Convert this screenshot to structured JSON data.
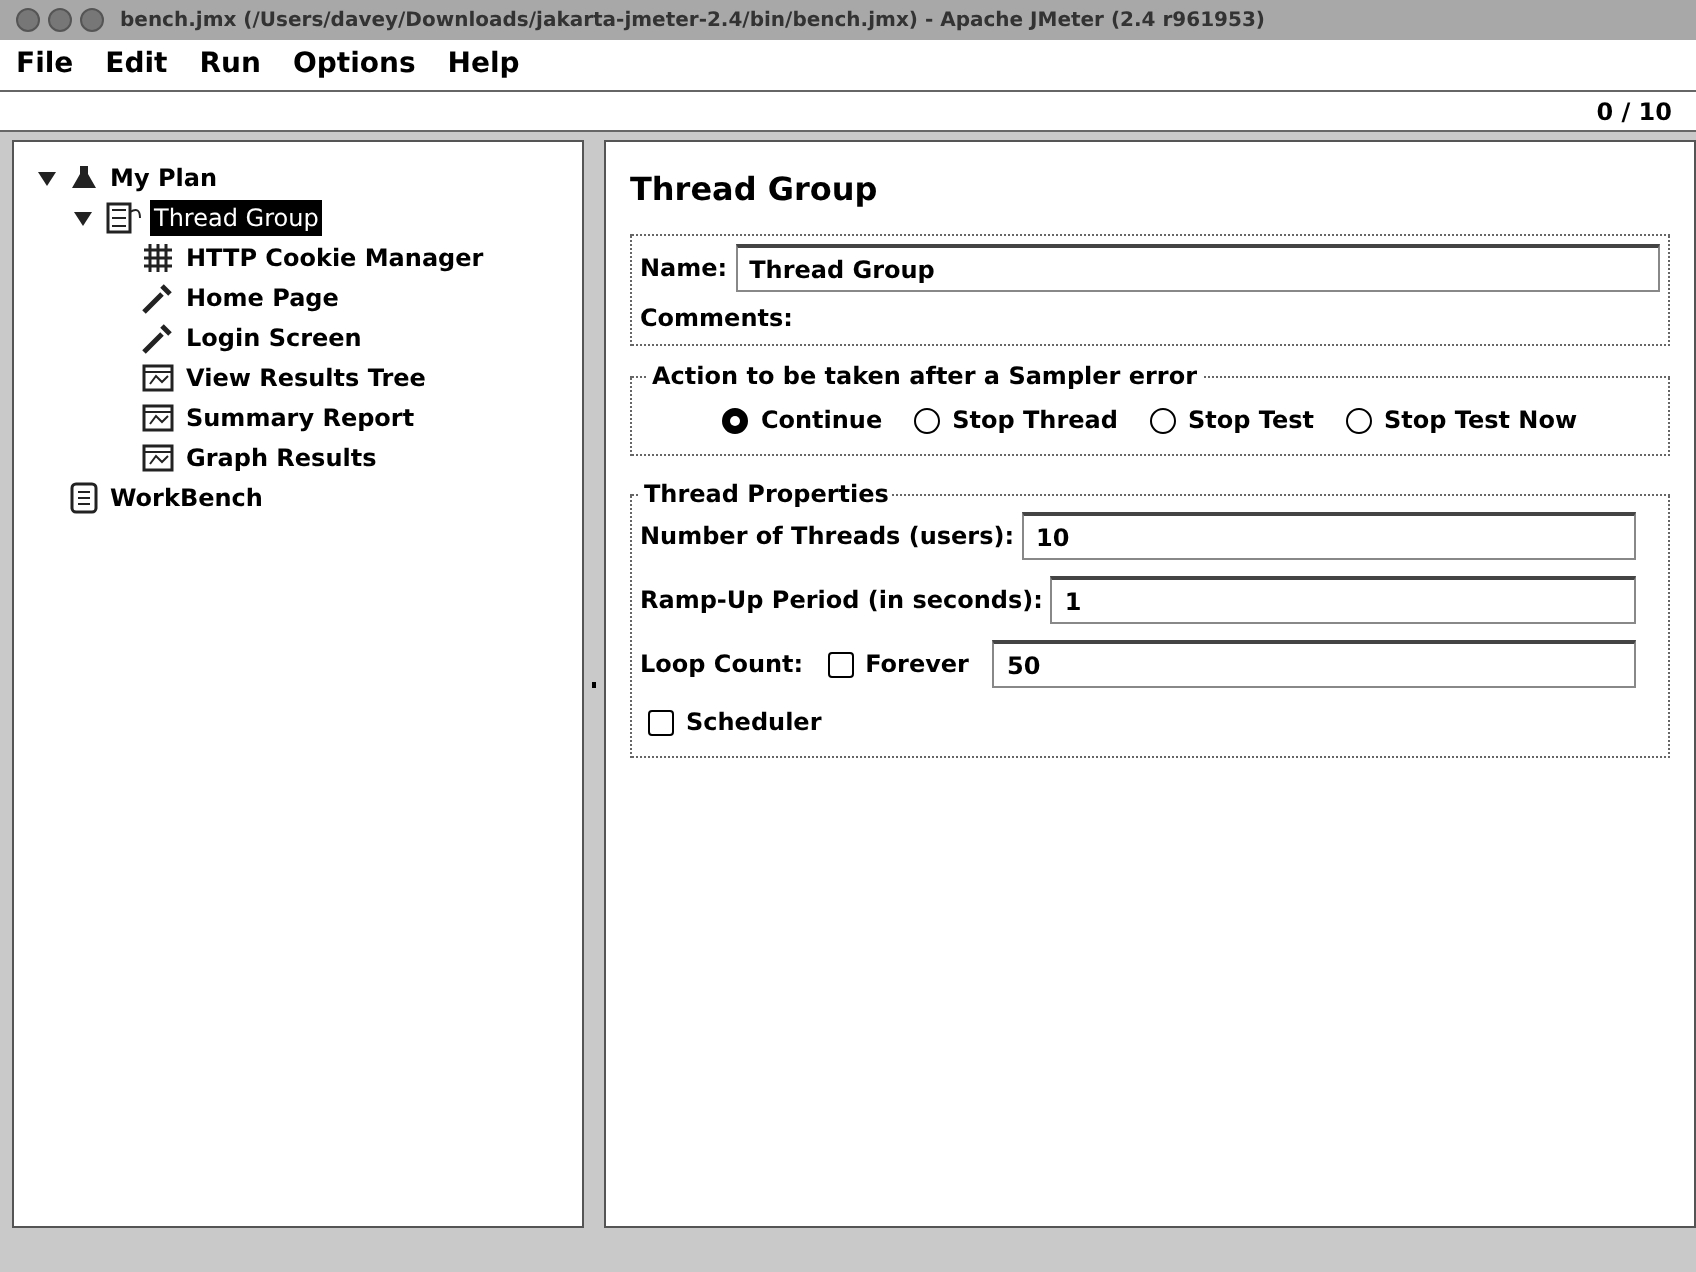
{
  "window": {
    "title": "bench.jmx (/Users/davey/Downloads/jakarta-jmeter-2.4/bin/bench.jmx) - Apache JMeter (2.4 r961953)"
  },
  "menu": [
    "File",
    "Edit",
    "Run",
    "Options",
    "Help"
  ],
  "toolbar": {
    "thread_count": "0 / 10"
  },
  "tree": [
    {
      "label": "My Plan",
      "kind": "plan",
      "selected": false,
      "expanded": true,
      "children": [
        {
          "label": "Thread Group",
          "kind": "threads",
          "selected": true,
          "expanded": true,
          "children": [
            {
              "label": "HTTP Cookie Manager",
              "kind": "config",
              "selected": false
            },
            {
              "label": "Home Page",
              "kind": "sampler",
              "selected": false
            },
            {
              "label": "Login Screen",
              "kind": "sampler",
              "selected": false
            },
            {
              "label": "View Results Tree",
              "kind": "listener",
              "selected": false
            },
            {
              "label": "Summary Report",
              "kind": "listener",
              "selected": false
            },
            {
              "label": "Graph Results",
              "kind": "listener",
              "selected": false
            }
          ]
        }
      ]
    },
    {
      "label": "WorkBench",
      "kind": "workbench",
      "selected": false
    }
  ],
  "panel": {
    "title": "Thread Group",
    "name_label": "Name:",
    "name_value": "Thread Group",
    "comments_label": "Comments:",
    "error_group": {
      "legend": "Action to be taken after a Sampler error",
      "options": [
        {
          "label": "Continue",
          "selected": true
        },
        {
          "label": "Stop Thread",
          "selected": false
        },
        {
          "label": "Stop Test",
          "selected": false
        },
        {
          "label": "Stop Test Now",
          "selected": false
        }
      ]
    },
    "properties": {
      "legend": "Thread Properties",
      "threads_label": "Number of Threads (users):",
      "threads_value": "10",
      "rampup_label": "Ramp-Up Period (in seconds):",
      "rampup_value": "1",
      "loop_label": "Loop Count:",
      "forever": {
        "label": "Forever",
        "checked": false
      },
      "loop_value": "50",
      "scheduler": {
        "label": "Scheduler",
        "checked": false
      }
    }
  }
}
